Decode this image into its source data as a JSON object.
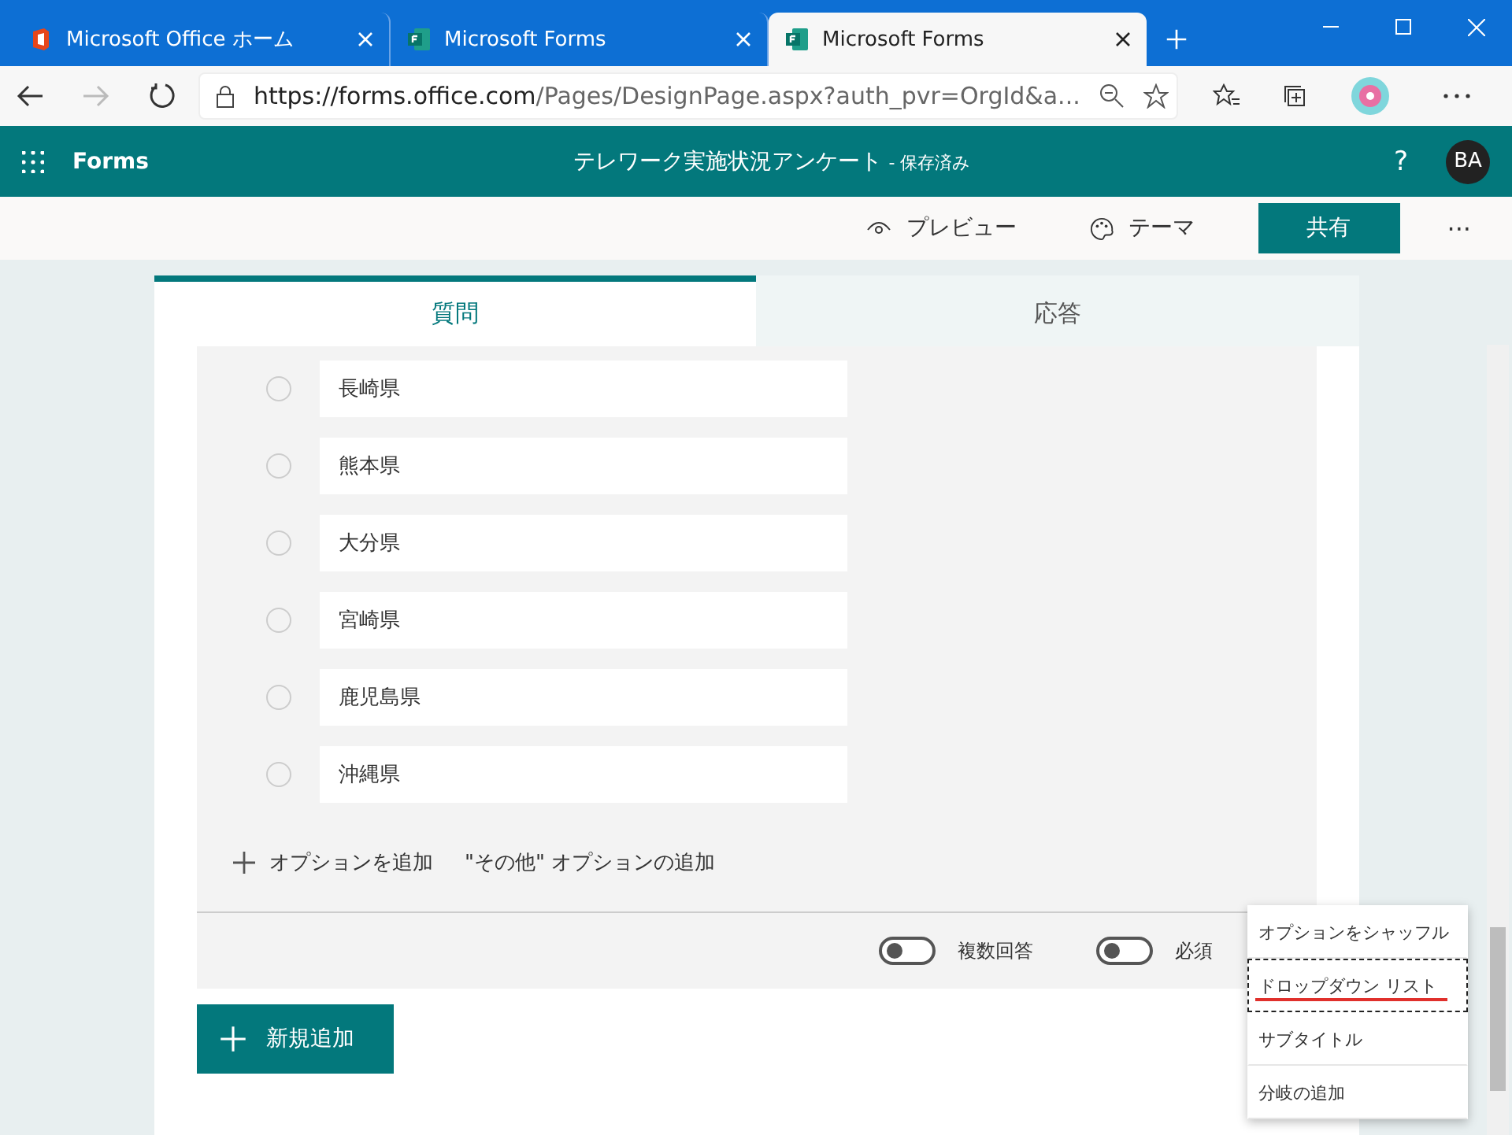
{
  "browser": {
    "tabs": [
      {
        "title": "Microsoft Office ホーム",
        "kind": "office",
        "selected": false
      },
      {
        "title": "Microsoft Forms",
        "kind": "forms",
        "selected": false
      },
      {
        "title": "Microsoft Forms",
        "kind": "forms",
        "selected": true
      }
    ],
    "url_host": "https://forms.office.com",
    "url_path": "/Pages/DesignPage.aspx?auth_pvr=OrgId&a..."
  },
  "app_bar": {
    "app": "Forms",
    "title": "テレワーク実施状況アンケート",
    "status": "- 保存済み",
    "help": "?",
    "avatar": "BA"
  },
  "toolbar": {
    "preview": "プレビュー",
    "theme": "テーマ",
    "share": "共有",
    "more": "···"
  },
  "tabs": [
    {
      "label": "質問",
      "selected": true
    },
    {
      "label": "応答",
      "selected": false
    }
  ],
  "options": [
    {
      "label": "長崎県",
      "selected": false
    },
    {
      "label": "熊本県",
      "selected": false
    },
    {
      "label": "大分県",
      "selected": false
    },
    {
      "label": "宮崎県",
      "selected": false
    },
    {
      "label": "鹿児島県",
      "selected": false
    },
    {
      "label": "沖縄県",
      "selected": false
    }
  ],
  "add_option": "オプションを追加",
  "add_other": "\"その他\" オプションの追加",
  "toggles": [
    {
      "label": "複数回答",
      "on": false
    },
    {
      "label": "必須",
      "on": false
    }
  ],
  "new_button": "新規追加",
  "menu": [
    {
      "label": "オプションをシャッフル",
      "selected": false
    },
    {
      "label": "ドロップダウン リスト",
      "selected": true
    },
    {
      "label": "サブタイトル",
      "selected": false
    },
    {
      "label": "分岐の追加",
      "selected": false
    }
  ]
}
